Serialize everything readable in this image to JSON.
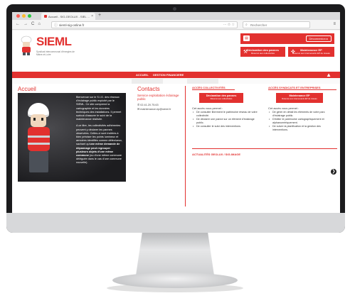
{
  "browser": {
    "tab_title": "Accueil - SIG-GEOLUX - SIEL ...",
    "tab_close": "×",
    "new_tab": "+",
    "nav": {
      "back": "←",
      "forward": "→",
      "reload": "C",
      "home": "⌂"
    },
    "url": "sieml-sig-online.fr",
    "url_icons": "··· ✩ ☆",
    "search_placeholder": "Rechercher",
    "menu": "≡",
    "dot_colors": [
      "#ff5f57",
      "#febc2e",
      "#28c840"
    ]
  },
  "header": {
    "logo_title": "SIEML",
    "logo_subtitle": "Syndicat intercommunal d'énergies de Maine-et-Loire",
    "logout_button": "Déconnexion ▸",
    "user_icon": "id-card-icon",
    "btn_declaration": {
      "line1": "Déclaration des pannes",
      "line2": "Réservé aux collectivités"
    },
    "btn_maintenance": {
      "line1": "Maintenance EP",
      "line2": "Réservé aux intervenants EP de réseau"
    }
  },
  "topnav": {
    "items": [
      "ACCUEIL",
      "GESTION FINANCIERE"
    ],
    "collapse": "▲"
  },
  "accueil": {
    "title": "Accueil",
    "para1": "Bienvenue sur le S.I.G. des réseaux d'éclairage public exploité par le SIEML. Ce site comprend la cartographie et les données techniques des installations. Il permet surtout d'assurer le suivi de la maintenance réalisée.",
    "para2_start": "A ce titre, les collectivités adhérentes peuvent y déclarer les pannes observées. Celles-ci sont invitées à bien préciser les points lumineux et armoires identifiés comme défectueux, sachant qu'",
    "para2_bold": "une même demande de dépannage peut regrouper plusieurs objets d'une même commune",
    "para2_end": " (ou d'une même commune déléguée dans le cas d'une commune nouvelle)."
  },
  "contacts": {
    "title": "Contacts",
    "subtitle": "Service exploitation éclairage public",
    "phone": "02.41.20.75.63",
    "email": "maintenance.ep@sieml.fr"
  },
  "collectivites": {
    "heading": "ACCÈS COLLECTIVITÉS",
    "button_l1": "Déclaration des pannes",
    "button_l2": "Réservé aux collectivités",
    "intro": "Cet accès vous permet :",
    "items": [
      "De consulter librement le patrimoine réseau de votre collectivité.",
      "De déclarer une panne sur un élément d'éclairage public.",
      "De consulter le suivi des interventions."
    ]
  },
  "syndicats": {
    "heading": "ACCÈS SYNDICATS ET ENTREPRISES",
    "button_l1": "Maintenance EP",
    "button_l2": "Réservé aux intervenants EP de réseau",
    "intro": "Cet accès vous permet :",
    "items": [
      "De gérer en détail les éléments de votre parc d'éclairage public.",
      "D'éditer le patrimoine cartographiquement et alphanumériquement.",
      "De suivre la planification et la gestion des interventions."
    ]
  },
  "actualites": {
    "title": "ACTUALITÉS GEOLUX / SIG-IMAGE",
    "next": "❯"
  },
  "colors": {
    "brand_red": "#e2312f",
    "bezel": "#1b1b1d",
    "chin": "#d7d8da"
  }
}
